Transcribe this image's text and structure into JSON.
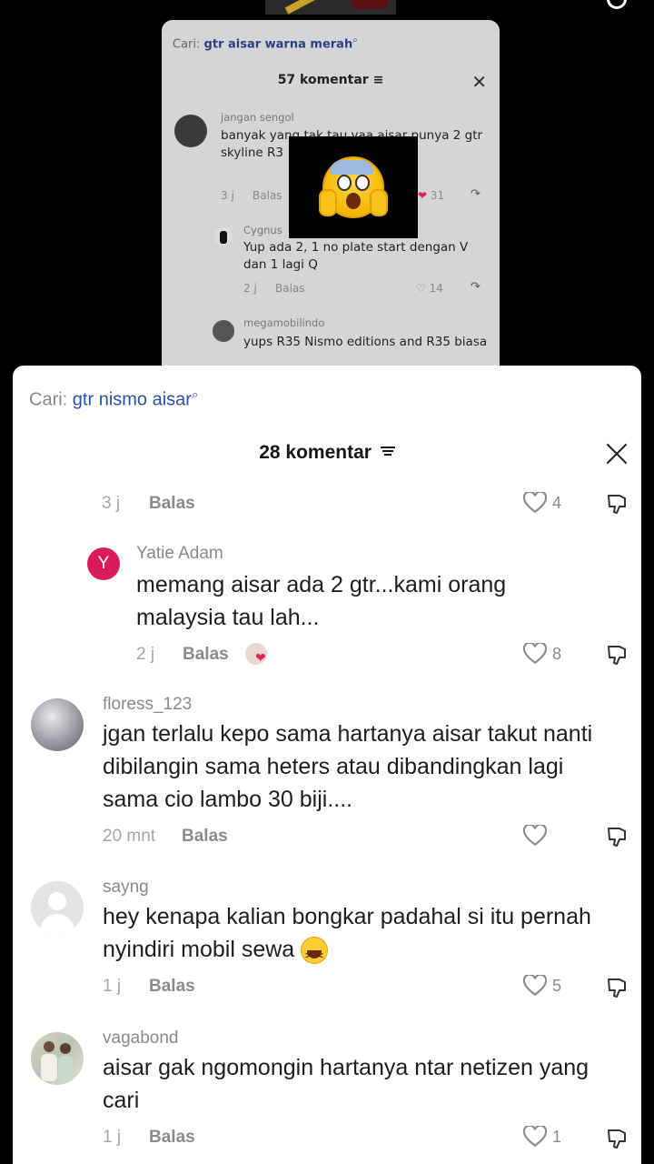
{
  "background_card": {
    "search_prefix": "Cari: ",
    "search_query": "gtr aisar warna merah",
    "comment_count": "57 komentar",
    "comments": [
      {
        "user": "jangan sengol",
        "text": "banyak yang tak tau yaa aisar punya 2 gtr\nskyline R3",
        "time": "3 j",
        "reply": "Balas",
        "likes": "31"
      },
      {
        "user": "Cygnus",
        "text": "Yup ada 2, 1 no plate start dengan V dan 1 lagi Q",
        "time": "2 j",
        "reply": "Balas",
        "likes": "14"
      },
      {
        "user": "megamobilindo",
        "text": "yups R35 Nismo editions and R35 biasa"
      }
    ]
  },
  "sheet": {
    "search_prefix": "Cari: ",
    "search_query": "gtr nismo aisar",
    "comment_count": "28 komentar",
    "top_row": {
      "time": "3 j",
      "reply": "Balas",
      "likes": "4"
    },
    "comments": [
      {
        "avatar_letter": "Y",
        "avatar_color": "#d81b5b",
        "user": "Yatie Adam",
        "text": "memang aisar ada 2 gtr...kami orang malaysia tau lah...",
        "time": "2 j",
        "reply": "Balas",
        "likes": "8"
      },
      {
        "user": "floress_123",
        "text": "jgan terlalu kepo sama hartanya aisar takut nanti dibilangin sama heters atau dibandingkan lagi sama cio lambo 30 biji....",
        "time": "20 mnt",
        "reply": "Balas",
        "likes": ""
      },
      {
        "user": "sayng",
        "text": "hey kenapa kalian bongkar padahal si itu pernah nyindiri mobil sewa",
        "time": "1 j",
        "reply": "Balas",
        "likes": "5"
      },
      {
        "user": "vagabond",
        "text": "aisar gak ngomongin hartanya ntar netizen yang cari",
        "time": "1 j",
        "reply": "Balas",
        "likes": "1"
      }
    ]
  },
  "colors": {
    "accent_blue": "#2b4fa8",
    "heart_red": "#e0245e",
    "avatar_pink": "#d81b5b"
  }
}
